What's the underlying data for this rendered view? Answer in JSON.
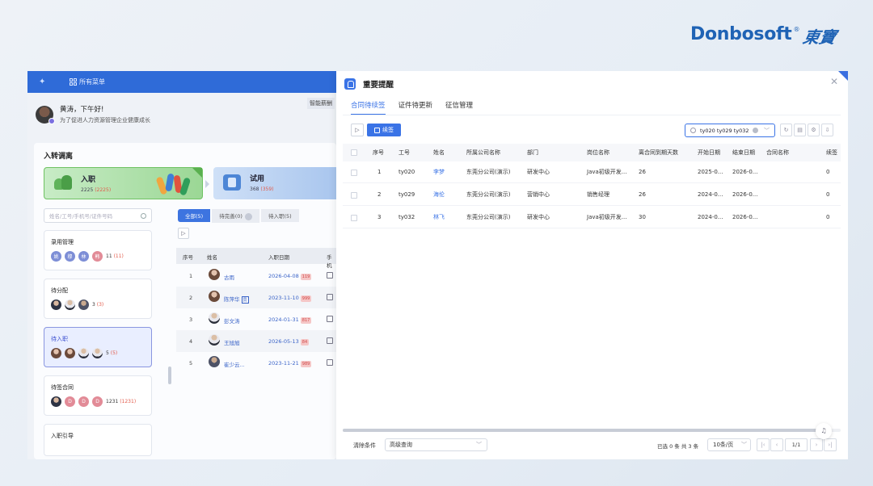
{
  "brand": {
    "name": "Donbosoft",
    "reg": "®",
    "cn": "東寶"
  },
  "topbar": {
    "menu_label": "所有菜单"
  },
  "greeting": {
    "title": "黄涛，下午好!",
    "subtitle": "为了促进人力资源管理企业健康成长",
    "smart_tag": "智能薪酬"
  },
  "section_title": "入转调离",
  "stages": [
    {
      "name": "入职",
      "count": "2225",
      "extra": "(2225)"
    },
    {
      "name": "试用",
      "count": "368",
      "extra": "(359)"
    }
  ],
  "left_search": {
    "placeholder": "姓名/工号/手机号/证件号码"
  },
  "groups": [
    {
      "title": "录用管理",
      "avatars": [
        "姚",
        "穆",
        "林",
        "韩"
      ],
      "count": "11",
      "extra": "(11)"
    },
    {
      "title": "待分配",
      "count": "3",
      "extra": "(3)"
    },
    {
      "title": "待入职",
      "count": "5",
      "extra": "(5)"
    },
    {
      "title": "待签合同",
      "avatars": [
        "D",
        "D",
        "D"
      ],
      "count": "1231",
      "extra": "(1231)"
    },
    {
      "title": "入职引导"
    }
  ],
  "left_tabs": [
    {
      "label": "全部(5)"
    },
    {
      "label": "待完善(0)"
    },
    {
      "label": "待入职(5)"
    }
  ],
  "left_table": {
    "headers": [
      "序号",
      "姓名",
      "入职日期",
      "手机"
    ],
    "rows": [
      {
        "idx": "1",
        "name": "古雨",
        "date": "2026-04-08",
        "days": "119"
      },
      {
        "idx": "2",
        "name": "陈萍华",
        "tag": "员",
        "date": "2023-11-10",
        "days": "999"
      },
      {
        "idx": "3",
        "name": "彭文涛",
        "date": "2024-01-31",
        "days": "817"
      },
      {
        "idx": "4",
        "name": "王旭旭",
        "date": "2026-05-13",
        "days": "84"
      },
      {
        "idx": "5",
        "name": "崔少云...",
        "date": "2023-11-21",
        "days": "989"
      }
    ]
  },
  "drawer": {
    "title": "重要提醒",
    "tabs": [
      "合同待续签",
      "证件待更新",
      "征信管理"
    ],
    "renew_button": "续签",
    "search_value": "ty020 ty029 ty032",
    "columns": [
      "序号",
      "工号",
      "姓名",
      "所属公司名称",
      "部门",
      "岗位名称",
      "离合同到期天数",
      "开始日期",
      "结束日期",
      "合同名称",
      "续签次"
    ],
    "rows": [
      {
        "idx": "1",
        "code": "ty020",
        "name": "李梦",
        "company": "东莞分公司(演示)",
        "dept": "研发中心",
        "position": "Java初级开发...",
        "days": "26",
        "start": "2025-0...",
        "end": "2026-0...",
        "contract": "",
        "renew": "0"
      },
      {
        "idx": "2",
        "code": "ty029",
        "name": "海伦",
        "company": "东莞分公司(演示)",
        "dept": "营销中心",
        "position": "销售经理",
        "days": "26",
        "start": "2024-0...",
        "end": "2026-0...",
        "contract": "",
        "renew": "0"
      },
      {
        "idx": "3",
        "code": "ty032",
        "name": "林飞",
        "company": "东莞分公司(演示)",
        "dept": "研发中心",
        "position": "Java初级开发...",
        "days": "30",
        "start": "2024-0...",
        "end": "2026-0...",
        "contract": "",
        "renew": "0"
      }
    ],
    "footer": {
      "clear": "清除条件",
      "advanced": "高级查询",
      "selected": "已选 0 条  共 3 条",
      "page_size": "10条/页",
      "page": "1/1"
    }
  }
}
